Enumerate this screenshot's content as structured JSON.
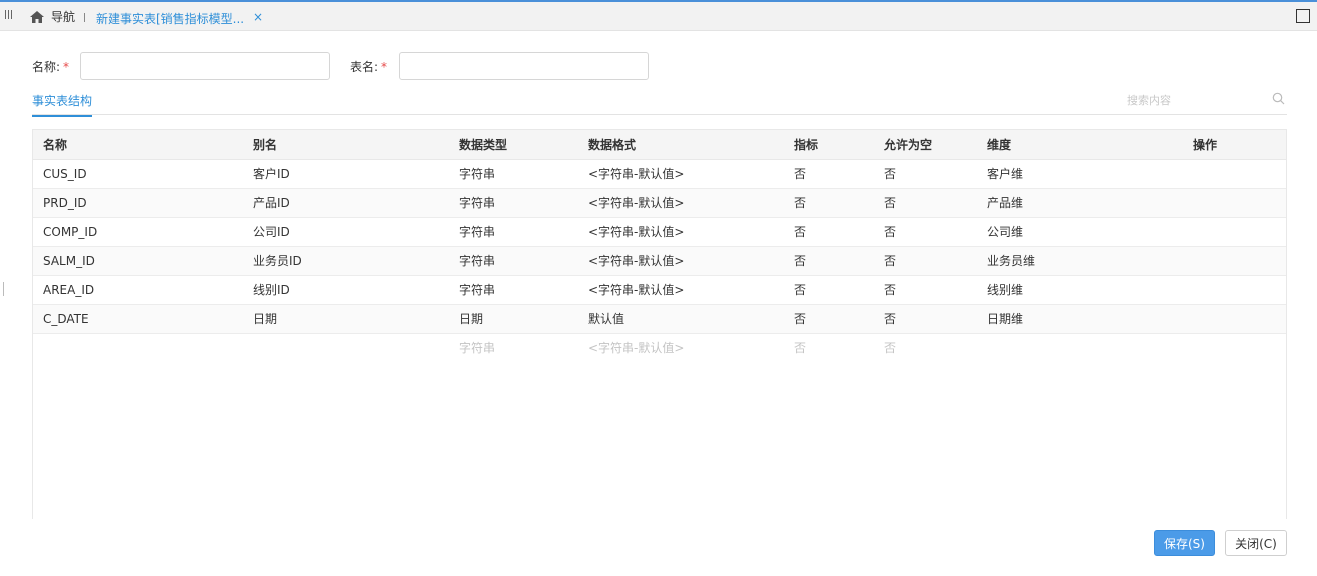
{
  "topbar": {
    "home_label": "导航",
    "active_tab": "新建事实表[销售指标模型...",
    "close_glyph": "×"
  },
  "form": {
    "name_label": "名称:",
    "name_value": "",
    "table_label": "表名:",
    "table_value": "",
    "required_mark": "*"
  },
  "tabs": {
    "active": "事实表结构",
    "search_placeholder": "搜索内容"
  },
  "table": {
    "columns": [
      "名称",
      "别名",
      "数据类型",
      "数据格式",
      "指标",
      "允许为空",
      "维度",
      "操作"
    ],
    "rows": [
      [
        "CUS_ID",
        "客户ID",
        "字符串",
        "<字符串-默认值>",
        "否",
        "否",
        "客户维",
        ""
      ],
      [
        "PRD_ID",
        "产品ID",
        "字符串",
        "<字符串-默认值>",
        "否",
        "否",
        "产品维",
        ""
      ],
      [
        "COMP_ID",
        "公司ID",
        "字符串",
        "<字符串-默认值>",
        "否",
        "否",
        "公司维",
        ""
      ],
      [
        "SALM_ID",
        "业务员ID",
        "字符串",
        "<字符串-默认值>",
        "否",
        "否",
        "业务员维",
        ""
      ],
      [
        "AREA_ID",
        "线别ID",
        "字符串",
        "<字符串-默认值>",
        "否",
        "否",
        "线别维",
        ""
      ],
      [
        "C_DATE",
        "日期",
        "日期",
        "默认值",
        "否",
        "否",
        "日期维",
        ""
      ]
    ],
    "empty_row": [
      "",
      "",
      "字符串",
      "<字符串-默认值>",
      "否",
      "否",
      "",
      ""
    ]
  },
  "buttons": {
    "save": "保存(S)",
    "close": "关闭(C)"
  },
  "colors": {
    "accent": "#2f8fd8",
    "primary_button": "#4b9be8",
    "required": "#e64a4a"
  }
}
